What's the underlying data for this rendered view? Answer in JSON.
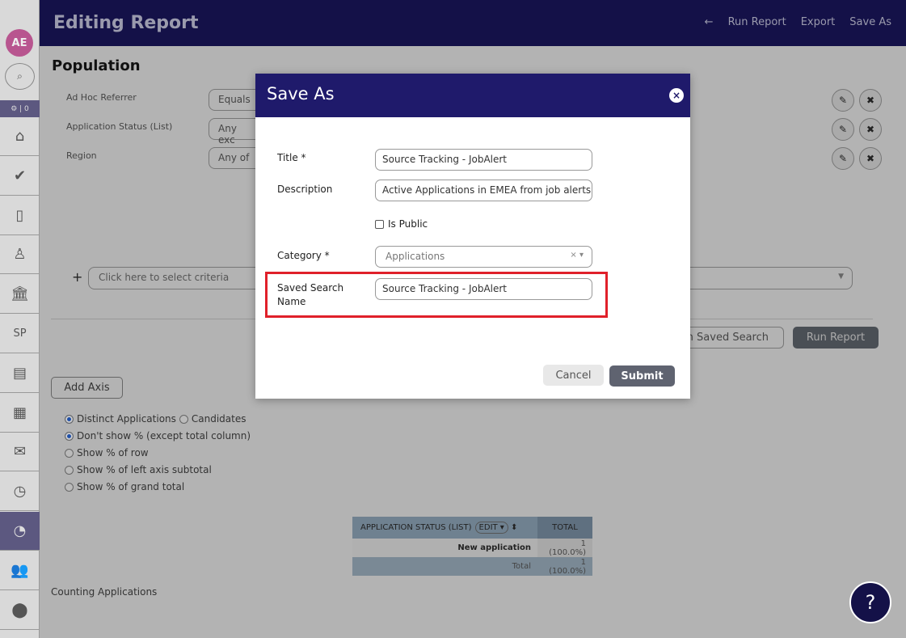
{
  "sidebar": {
    "avatar": "AE",
    "badge": "⚙ | 0",
    "items": [
      {
        "name": "home-icon",
        "glyph": "⌂"
      },
      {
        "name": "check-icon",
        "glyph": "✔"
      },
      {
        "name": "document-icon",
        "glyph": "▯"
      },
      {
        "name": "candidate-icon",
        "glyph": "♙"
      },
      {
        "name": "bank-icon",
        "glyph": "🏛"
      },
      {
        "name": "sp-label",
        "glyph": "SP"
      },
      {
        "name": "job-board-icon",
        "glyph": "▤"
      },
      {
        "name": "calendar-icon",
        "glyph": "▦"
      },
      {
        "name": "mail-icon",
        "glyph": "✉"
      },
      {
        "name": "clock-icon",
        "glyph": "◷"
      },
      {
        "name": "reports-pie-icon",
        "glyph": "◔"
      },
      {
        "name": "users-icon",
        "glyph": "👥"
      },
      {
        "name": "location-icon",
        "glyph": "⬤"
      }
    ]
  },
  "header": {
    "title": "Editing Report",
    "back": "←",
    "run_report": "Run Report",
    "export": "Export",
    "save_as": "Save As"
  },
  "population": {
    "title": "Population",
    "criteria": [
      {
        "label": "Ad Hoc Referrer",
        "operator": "Equals"
      },
      {
        "label": "Application Status (List)",
        "operator": "Any exc"
      },
      {
        "label": "Region",
        "operator": "Any of"
      }
    ],
    "add_plus": "+",
    "criteria_placeholder": "Click here to select criteria"
  },
  "actions": {
    "saved_search": "m Saved Search",
    "run_report": "Run Report",
    "add_axis": "Add Axis"
  },
  "options": {
    "distinct_applications": "Distinct Applications",
    "candidates": "Candidates",
    "dont_show": "Don't show % (except total column)",
    "show_row": "Show % of row",
    "show_left": "Show % of left axis subtotal",
    "show_grand": "Show % of grand total"
  },
  "table": {
    "header": "APPLICATION STATUS (LIST)",
    "edit": "EDIT ▾",
    "total_header": "TOTAL",
    "rows": [
      {
        "label": "New application",
        "value": "1 (100.0%)"
      },
      {
        "label": "Total",
        "value": "1 (100.0%)"
      }
    ]
  },
  "counting": "Counting Applications",
  "help": "?",
  "modal": {
    "title": "Save As",
    "close": "×",
    "title_label": "Title *",
    "title_value": "Source Tracking - JobAlert",
    "description_label": "Description",
    "description_value": "Active Applications in EMEA from job alerts",
    "is_public": "Is Public",
    "category_label": "Category *",
    "category_value": "Applications",
    "saved_search_label": "Saved Search Name",
    "saved_search_value": "Source Tracking - JobAlert",
    "cancel": "Cancel",
    "submit": "Submit"
  },
  "colors": {
    "header": "#141148",
    "modal_header": "#1f1a6b",
    "highlight": "#e0202a"
  }
}
